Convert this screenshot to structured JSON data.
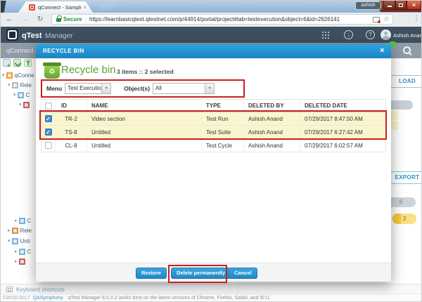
{
  "browser": {
    "tab_title": "qConnect - Sample Proj",
    "profile_name": "ashish",
    "secure_label": "Secure",
    "url": "https://learnbasicqtest.qtestnet.com/p/44914/portal/project#tab=testexecution&object=6&id=2626141"
  },
  "icons": {
    "back": "←",
    "forward": "→",
    "reload": "↻",
    "star": "☆",
    "menu_dots": "⋮",
    "window_close": "×",
    "tab_close": "×",
    "download": "↓",
    "help": "?",
    "modal_close": "×",
    "recycle": "♻",
    "check": "✓",
    "caret_down": "▾"
  },
  "header": {
    "brand": "qTest",
    "product": "Manager",
    "user_name": "Ashish Anand"
  },
  "subheader": {
    "project_name": "qConnect -"
  },
  "sidebar": {
    "tree": [
      {
        "arrow": "▾",
        "label": "qConne"
      },
      {
        "arrow": "▾",
        "label": "Rele"
      },
      {
        "arrow": "▾",
        "label": "C"
      },
      {
        "arrow": "▾",
        "label": ""
      },
      {
        "arrow": "▸",
        "label": "C"
      },
      {
        "arrow": "▸",
        "label": "Rele"
      },
      {
        "arrow": "▾",
        "label": "Unti"
      },
      {
        "arrow": "▸",
        "label": "C"
      },
      {
        "arrow": "▸",
        "label": ""
      }
    ]
  },
  "background_right": {
    "upload_label_visible": "LOAD",
    "export_label": "EXPORT",
    "badge_gray": "6",
    "badge_yellow": "3"
  },
  "modal": {
    "titlebar_label": "RECYCLE BIN",
    "title": "Recycle bin",
    "summary": "3 items :: 2 selected",
    "filters": {
      "menu_label": "Menu",
      "menu_value": "Test Execution",
      "objects_label": "Object(s)",
      "objects_value": "All"
    },
    "table": {
      "columns": [
        "ID",
        "NAME",
        "TYPE",
        "DELETED BY",
        "DELETED DATE"
      ],
      "rows": [
        {
          "id": "TR-2",
          "name": "Video section",
          "type": "Test Run",
          "deleted_by": "Ashish Anand",
          "deleted_date": "07/29/2017 8:47:50 AM",
          "checked": true
        },
        {
          "id": "TS-8",
          "name": "Untitled",
          "type": "Test Suite",
          "deleted_by": "Ashish Anand",
          "deleted_date": "07/29/2017 6:27:42 AM",
          "checked": true
        },
        {
          "id": "CL-8",
          "name": "Untitled",
          "type": "Test Cycle",
          "deleted_by": "Ashish Anand",
          "deleted_date": "07/29/2017 6:02:57 AM",
          "checked": false
        }
      ]
    },
    "buttons": {
      "restore": "Restore",
      "delete": "Delete permanently",
      "cancel": "Cancel"
    }
  },
  "statusbar": {
    "keyboard_shortcuts": "Keyboard shortcuts"
  },
  "footer": {
    "copyright": "©2010-2017",
    "company": "QASymphony",
    "note": "qTest Manager 8.5.3.2 works best on the latest versions of Chrome, Firefox, Safari, and IE11."
  },
  "colors": {
    "accent_blue": "#2094d4",
    "brand_green": "#5ba033",
    "highlight_yellow": "#fbf5cd",
    "annotation_red": "#c9211e",
    "checkbox_blue": "#3f8fd6"
  }
}
